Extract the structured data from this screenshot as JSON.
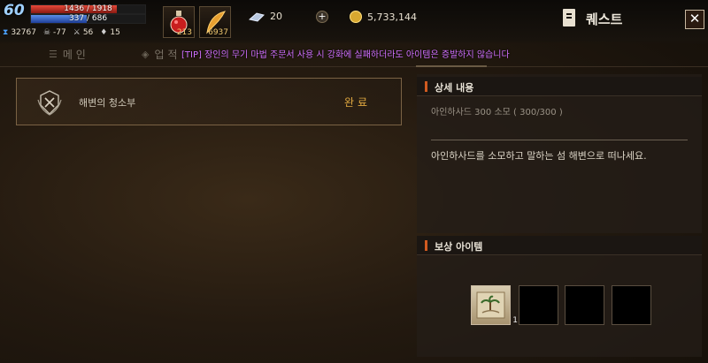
{
  "hud": {
    "level": "60",
    "hp": {
      "text": "1436 / 1918",
      "fraction": 0.749
    },
    "mp": {
      "text": "337 / 686",
      "fraction": 0.491
    },
    "stats": [
      {
        "icon": "hourglass-icon",
        "value": "32767"
      },
      {
        "icon": "skull-icon",
        "value": "-77"
      },
      {
        "icon": "sword-icon",
        "value": "56"
      },
      {
        "icon": "gem-icon",
        "value": "15"
      }
    ],
    "potion_count": "213",
    "feather_count": "6937",
    "crystal_count": "20",
    "gold": "5,733,144",
    "window_title": "퀘스트"
  },
  "tabs": {
    "main_label": "메 인",
    "second_label": "업 적"
  },
  "tip": "[TIP] 장인의 무기 마법 주문서 사용 시 강화에 실패하더라도 아이템은 증발하지 않습니다",
  "quest_list": [
    {
      "name": "해변의 청소부",
      "status": "완료"
    }
  ],
  "detail": {
    "header": "상세 내용",
    "progress": "아인하사드 300 소모 ( 300/300 )",
    "description": "아인하사드를 소모하고 말하는 섬 해변으로 떠나세요."
  },
  "reward": {
    "header": "보상 아이템",
    "items": [
      {
        "icon": "treasure-map-icon",
        "qty": "1"
      }
    ]
  },
  "colors": {
    "accent_orange": "#d05a20",
    "status_gold": "#e0a840",
    "tip_purple": "#d070ff"
  }
}
